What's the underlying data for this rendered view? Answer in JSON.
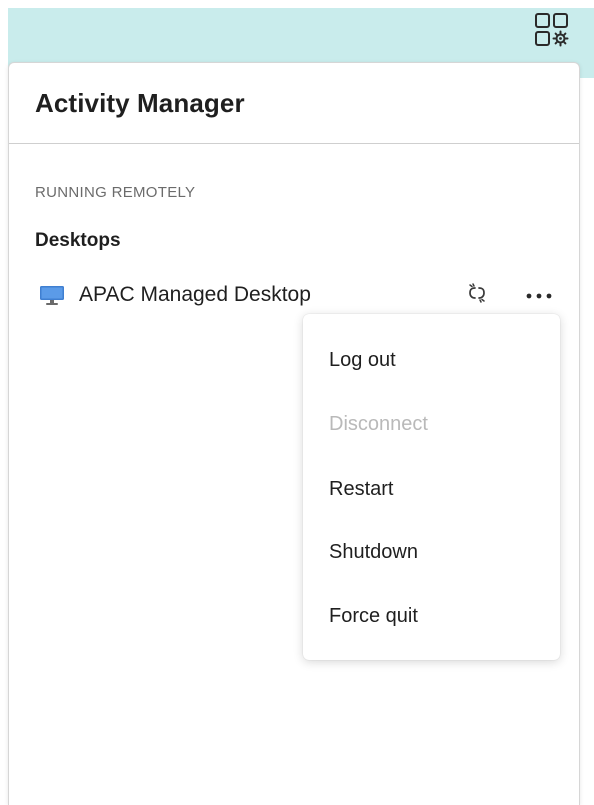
{
  "panel": {
    "title": "Activity Manager",
    "section_label": "RUNNING REMOTELY",
    "group_label": "Desktops"
  },
  "desktops": [
    {
      "name": "APAC Managed Desktop",
      "icon": "monitor-icon",
      "actions": [
        "unlink-icon",
        "more-icon"
      ]
    }
  ],
  "menu": {
    "items": [
      {
        "label": "Log out",
        "enabled": true
      },
      {
        "label": "Disconnect",
        "enabled": false
      },
      {
        "label": "Restart",
        "enabled": true
      },
      {
        "label": "Shutdown",
        "enabled": true
      },
      {
        "label": "Force quit",
        "enabled": true
      }
    ]
  },
  "colors": {
    "top_bar": "#c9ecec",
    "monitor_blue": "#3f7fd1",
    "text": "#1f1f1f",
    "muted_text": "#6b6b6b",
    "disabled_text": "#b9b9b9"
  },
  "icons": {
    "top_right": "apps-gear-icon"
  }
}
